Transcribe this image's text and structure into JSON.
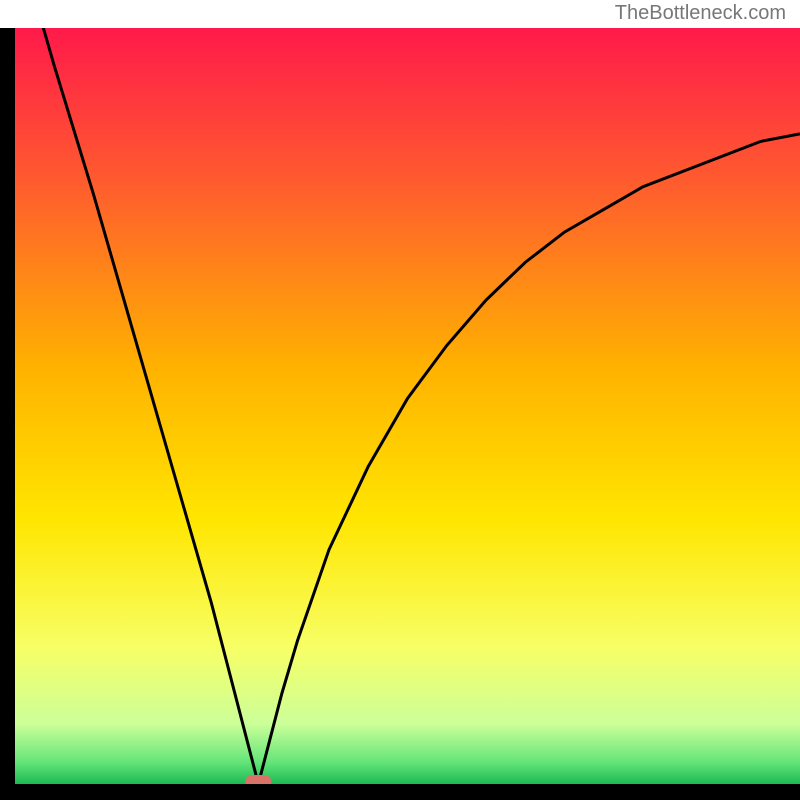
{
  "watermark": "TheBottleneck.com",
  "chart_data": {
    "type": "line",
    "title": "",
    "xlabel": "",
    "ylabel": "",
    "xlim": [
      0,
      100
    ],
    "ylim": [
      0,
      100
    ],
    "minimum_x": 31,
    "series": [
      {
        "name": "curve",
        "x": [
          0,
          5,
          10,
          15,
          20,
          25,
          28,
          30,
          31,
          32,
          34,
          36,
          40,
          45,
          50,
          55,
          60,
          65,
          70,
          75,
          80,
          85,
          90,
          95,
          100
        ],
        "values": [
          113,
          95,
          78,
          60,
          42,
          24,
          12,
          4,
          0,
          4,
          12,
          19,
          31,
          42,
          51,
          58,
          64,
          69,
          73,
          76,
          79,
          81,
          83,
          85,
          86
        ]
      }
    ],
    "marker": {
      "x": 31,
      "y": 0,
      "color": "#d9736a"
    },
    "gradient_stops": [
      {
        "offset": 0.0,
        "color": "#ff1a4a"
      },
      {
        "offset": 0.2,
        "color": "#ff5a2f"
      },
      {
        "offset": 0.45,
        "color": "#ffb200"
      },
      {
        "offset": 0.65,
        "color": "#ffe600"
      },
      {
        "offset": 0.82,
        "color": "#f7ff66"
      },
      {
        "offset": 0.92,
        "color": "#ccff99"
      },
      {
        "offset": 0.97,
        "color": "#66e67a"
      },
      {
        "offset": 1.0,
        "color": "#1db954"
      }
    ],
    "colors": {
      "frame": "#000000",
      "curve": "#000000",
      "marker": "#d9736a"
    }
  }
}
